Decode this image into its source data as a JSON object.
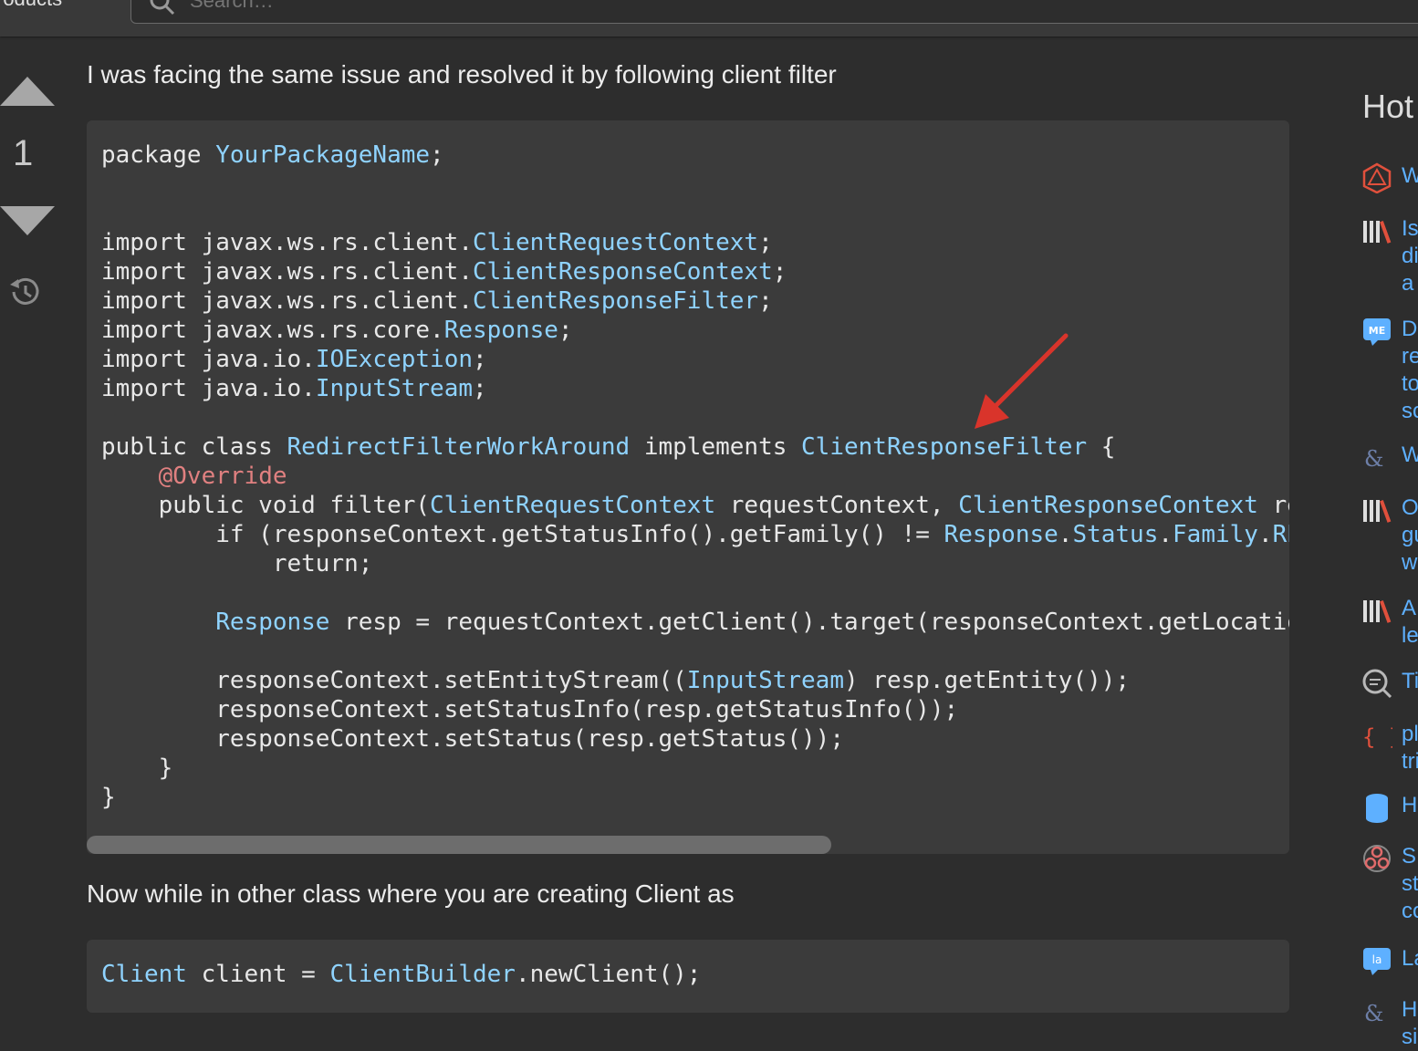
{
  "topbar": {
    "products_label": "roducts",
    "search_placeholder": "Search…"
  },
  "vote": {
    "count": "1"
  },
  "answer": {
    "paragraph1": "I was facing the same issue and resolved it by following client filter",
    "paragraph2": "Now while in other class where you are creating Client as"
  },
  "code1": {
    "lines": [
      [
        {
          "t": "package "
        },
        {
          "t": "YourPackageName",
          "c": "type"
        },
        {
          "t": ";"
        }
      ],
      [],
      [],
      [
        {
          "t": "import javax.ws.rs.client."
        },
        {
          "t": "ClientRequestContext",
          "c": "type"
        },
        {
          "t": ";"
        }
      ],
      [
        {
          "t": "import javax.ws.rs.client."
        },
        {
          "t": "ClientResponseContext",
          "c": "type"
        },
        {
          "t": ";"
        }
      ],
      [
        {
          "t": "import javax.ws.rs.client."
        },
        {
          "t": "ClientResponseFilter",
          "c": "type"
        },
        {
          "t": ";"
        }
      ],
      [
        {
          "t": "import javax.ws.rs.core."
        },
        {
          "t": "Response",
          "c": "type"
        },
        {
          "t": ";"
        }
      ],
      [
        {
          "t": "import java.io."
        },
        {
          "t": "IOException",
          "c": "type"
        },
        {
          "t": ";"
        }
      ],
      [
        {
          "t": "import java.io."
        },
        {
          "t": "InputStream",
          "c": "type"
        },
        {
          "t": ";"
        }
      ],
      [],
      [
        {
          "t": "public class "
        },
        {
          "t": "RedirectFilterWorkAround",
          "c": "type"
        },
        {
          "t": " implements "
        },
        {
          "t": "ClientResponseFilter",
          "c": "type"
        },
        {
          "t": " {"
        }
      ],
      [
        {
          "t": "    "
        },
        {
          "t": "@Override",
          "c": "anno"
        }
      ],
      [
        {
          "t": "    public void filter("
        },
        {
          "t": "ClientRequestContext",
          "c": "type"
        },
        {
          "t": " requestContext, "
        },
        {
          "t": "ClientResponseContext",
          "c": "type"
        },
        {
          "t": " responseContext)"
        }
      ],
      [
        {
          "t": "        if (responseContext.getStatusInfo().getFamily() != "
        },
        {
          "t": "Response",
          "c": "type"
        },
        {
          "t": "."
        },
        {
          "t": "Status",
          "c": "type"
        },
        {
          "t": "."
        },
        {
          "t": "Family",
          "c": "type"
        },
        {
          "t": "."
        },
        {
          "t": "REDIRECTION",
          "c": "type"
        },
        {
          "t": ")"
        }
      ],
      [
        {
          "t": "            return;"
        }
      ],
      [],
      [
        {
          "t": "        "
        },
        {
          "t": "Response",
          "c": "type"
        },
        {
          "t": " resp = requestContext.getClient().target(responseContext.getLocation()).request().get();"
        }
      ],
      [],
      [
        {
          "t": "        responseContext.setEntityStream(("
        },
        {
          "t": "InputStream",
          "c": "type"
        },
        {
          "t": ") resp.getEntity());"
        }
      ],
      [
        {
          "t": "        responseContext.setStatusInfo(resp.getStatusInfo());"
        }
      ],
      [
        {
          "t": "        responseContext.setStatus(resp.getStatus());"
        }
      ],
      [
        {
          "t": "    }"
        }
      ],
      [
        {
          "t": "}"
        }
      ]
    ]
  },
  "code2": {
    "lines": [
      [
        {
          "t": "Client",
          "c": "type"
        },
        {
          "t": " client = "
        },
        {
          "t": "ClientBuilder",
          "c": "type"
        },
        {
          "t": ".newClient();"
        }
      ]
    ]
  },
  "sidebar": {
    "title": "Hot",
    "items": [
      {
        "icon": "dice-icon",
        "text": "W",
        "color": "#e0503c"
      },
      {
        "icon": "books-icon",
        "text": "Is\ndi\na",
        "color": "#d9d9d9"
      },
      {
        "icon": "meta-bubble-icon",
        "text": "D\nre\nto\nsc",
        "color": "#5eb0ff"
      },
      {
        "icon": "ampersand-icon",
        "text": "W",
        "color": "#6d7fa8"
      },
      {
        "icon": "books-icon",
        "text": "O\ngu\nw",
        "color": "#d9d9d9"
      },
      {
        "icon": "books-icon",
        "text": "A\nle",
        "color": "#d9d9d9"
      },
      {
        "icon": "magnifier-icon",
        "text": "Ti",
        "color": "#b8b8b8"
      },
      {
        "icon": "braces-icon",
        "text": "pl\ntri",
        "color": "#e0503c"
      },
      {
        "icon": "database-icon",
        "text": "H",
        "color": "#5eb0ff"
      },
      {
        "icon": "biohazard-icon",
        "text": "S\nst\nco",
        "color": "#e06a6a"
      },
      {
        "icon": "latex-bubble-icon",
        "text": "La",
        "color": "#5eb0ff"
      },
      {
        "icon": "ampersand-icon",
        "text": "H\nsi",
        "color": "#6d7fa8"
      }
    ]
  }
}
